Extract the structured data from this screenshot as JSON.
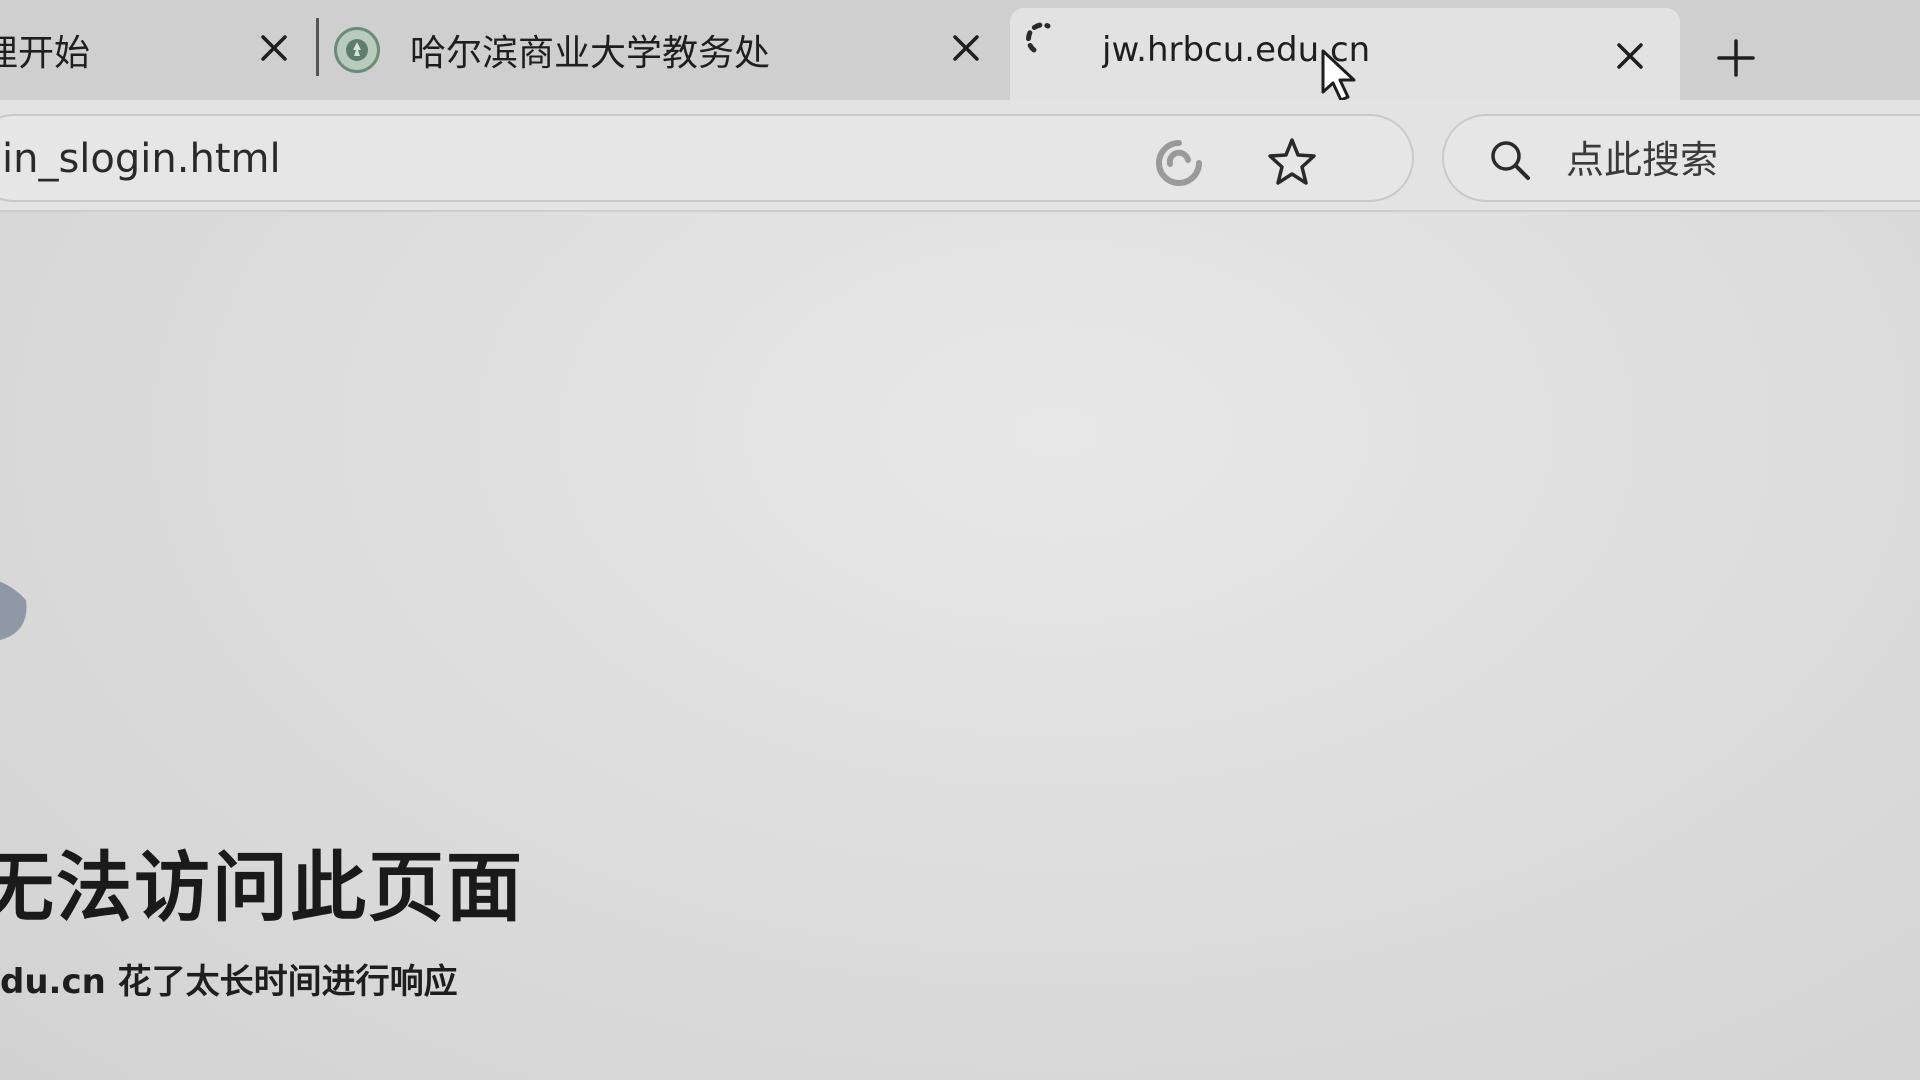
{
  "tabs": [
    {
      "title": "浬开始",
      "active": false
    },
    {
      "title": "哈尔滨商业大学教务处",
      "active": false
    },
    {
      "title": "jw.hrbcu.edu.cn",
      "active": true,
      "loading": true
    }
  ],
  "tab_close_glyph": "✕",
  "new_tab_glyph": "+",
  "address_bar": {
    "url": "in_slogin.html"
  },
  "search": {
    "placeholder": "点此搜索"
  },
  "error_page": {
    "title": "无法访问此页面",
    "detail": "du.cn 花了太长时间进行响应"
  },
  "icons": [
    "tab-favicon-icon",
    "loading-spinner-icon",
    "close-icon",
    "plus-icon",
    "reader-icon",
    "star-icon",
    "search-icon",
    "sad-face-icon",
    "cursor-icon"
  ],
  "colors": {
    "background": "#dedede",
    "tabstrip": "#cfcfcf",
    "active_tab": "#e2e2e2",
    "text": "#1a1a1a",
    "favicon_green": "#6b8c77"
  }
}
